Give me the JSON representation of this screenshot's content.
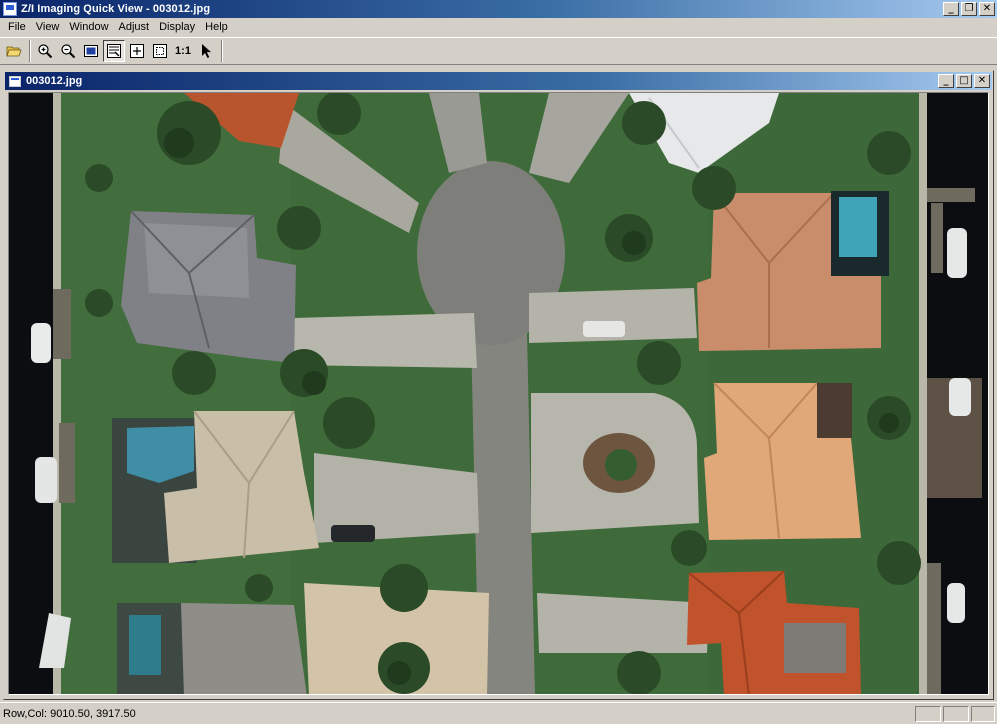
{
  "window": {
    "title": "Z/I Imaging Quick View - 003012.jpg",
    "minimize_glyph": "_",
    "restore_glyph": "❐",
    "close_glyph": "✕"
  },
  "menubar": {
    "items": [
      {
        "label": "File"
      },
      {
        "label": "View"
      },
      {
        "label": "Window"
      },
      {
        "label": "Adjust"
      },
      {
        "label": "Display"
      },
      {
        "label": "Help"
      }
    ]
  },
  "toolbar": {
    "one_to_one_label": "1:1",
    "buttons": [
      "open-folder-icon",
      "zoom-in-icon",
      "zoom-out-icon",
      "fit-window-icon",
      "pan-icon",
      "zoom-box-icon",
      "fit-image-icon",
      "one-to-one-icon",
      "pointer-icon"
    ]
  },
  "document": {
    "title": "003012.jpg",
    "minimize_glyph": "_",
    "maximize_glyph": "□",
    "close_glyph": "✕"
  },
  "statusbar": {
    "text": "Row,Col: 9010.50, 3917.50"
  },
  "colors": {
    "titlebar_start": "#0a246a",
    "titlebar_end": "#a6caf0",
    "chrome": "#d4d0c8",
    "lawn": "#3f6b3a",
    "road": "#8a8a86",
    "water": "#0b0d10"
  }
}
